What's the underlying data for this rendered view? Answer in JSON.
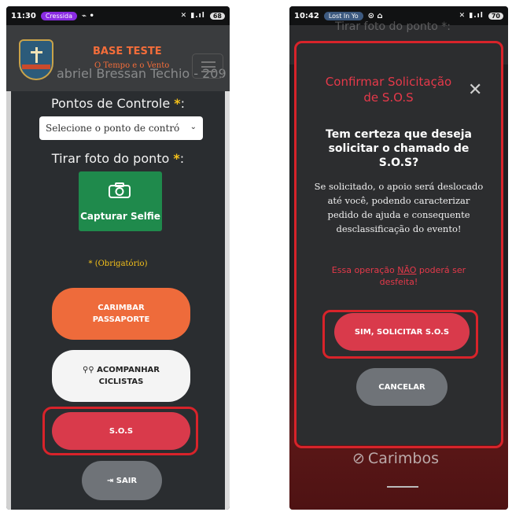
{
  "left": {
    "status": {
      "time": "11:30",
      "app": "Cressida",
      "battery": "68"
    },
    "header": {
      "brand_title": "BASE TESTE",
      "brand_subtitle": "O Tempo e o Vento",
      "ghost_name": "abriel Bressan Techio - 209"
    },
    "form": {
      "controle_label": "Pontos de Controle",
      "controle_req": "*",
      "select_placeholder": "Selecione o ponto de contró",
      "foto_label": "Tirar foto do ponto",
      "foto_req": "*",
      "selfie_label": "Capturar Selfie",
      "obrigatorio": "* (Obrigatório)"
    },
    "buttons": {
      "carimbar_line1": "CARIMBAR",
      "carimbar_line2": "PASSAPORTE",
      "acompanhar_line1": "ACOMPANHAR",
      "acompanhar_line2": "CICLISTAS",
      "sos": "S.O.S",
      "sair": "SAIR"
    }
  },
  "right": {
    "status": {
      "time": "10:42",
      "app": "Lost In Yo",
      "battery": "70"
    },
    "ghost_top": "Tirar foto do ponto *:",
    "modal": {
      "title_line1": "Confirmar Solicitação",
      "title_line2": "de S.O.S",
      "question": "Tem certeza que deseja solicitar o chamado de S.O.S?",
      "body": "Se solicitado, o apoio será deslocado até você, podendo caracterizar pedido de ajuda e consequente desclassificação do evento!",
      "warn_pre": "Essa operação ",
      "warn_nao": "NÃO",
      "warn_post": " poderá ser desfeita!",
      "confirm": "SIM, SOLICITAR S.O.S",
      "cancel": "CANCELAR"
    },
    "footer": {
      "carimbos": "Carimbos"
    }
  },
  "colors": {
    "accent_red": "#d93a4b",
    "accent_orange": "#ee6b3b",
    "success_green": "#1f8a4c",
    "required_yellow": "#f6c21a",
    "highlight": "#d8232a"
  }
}
